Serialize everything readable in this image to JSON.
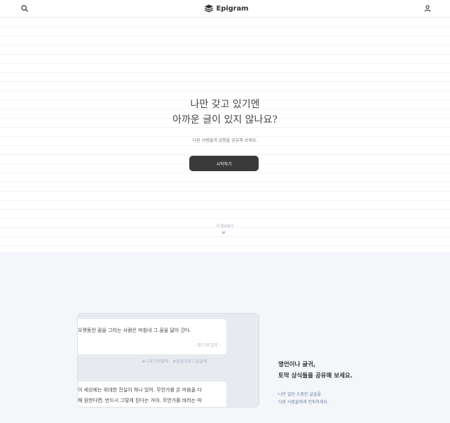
{
  "header": {
    "logo_text": "Epigram",
    "search_icon": "search-icon",
    "user_icon": "user-icon",
    "logo_icon": "stacked-layers-icon"
  },
  "hero": {
    "title_line1": "나만 갖고 있기엔",
    "title_line2": "아까운 글이 있지 않나요?",
    "subtitle": "다른 사람들과 감정을 공유해 보세요.",
    "start_button": "시작하기",
    "more_label": "더 알아보기",
    "more_icon": "chevron-down-icon"
  },
  "feature": {
    "card1_text": "오랫동안 꿈을 그리는 사람은 마침내 그 꿈을 닮아 간다.",
    "card1_author": "- 앙드레 말로 -",
    "tag1": "#나아가야할때",
    "tag2": "#꿈을이루고싶을때",
    "card2_line1": "이 세상에는 위대한 진실이 하나 있어. 무언가를 온 마음을 다",
    "card2_line2": "해 원한다면, 반드시 그렇게 된다는 거야. 무언가를 바라는 마",
    "title_line1": "명언이나 글귀,",
    "title_line2": "토막 상식들을 공유해 보세요.",
    "desc_line1": "나만 알던 소중한 글들을",
    "desc_line2": "다른 사람들에게 전파하세요."
  },
  "colors": {
    "button_bg": "#3a3a3a",
    "accent_text": "#6d7fa3",
    "section_bg": "#f4f6f9"
  }
}
